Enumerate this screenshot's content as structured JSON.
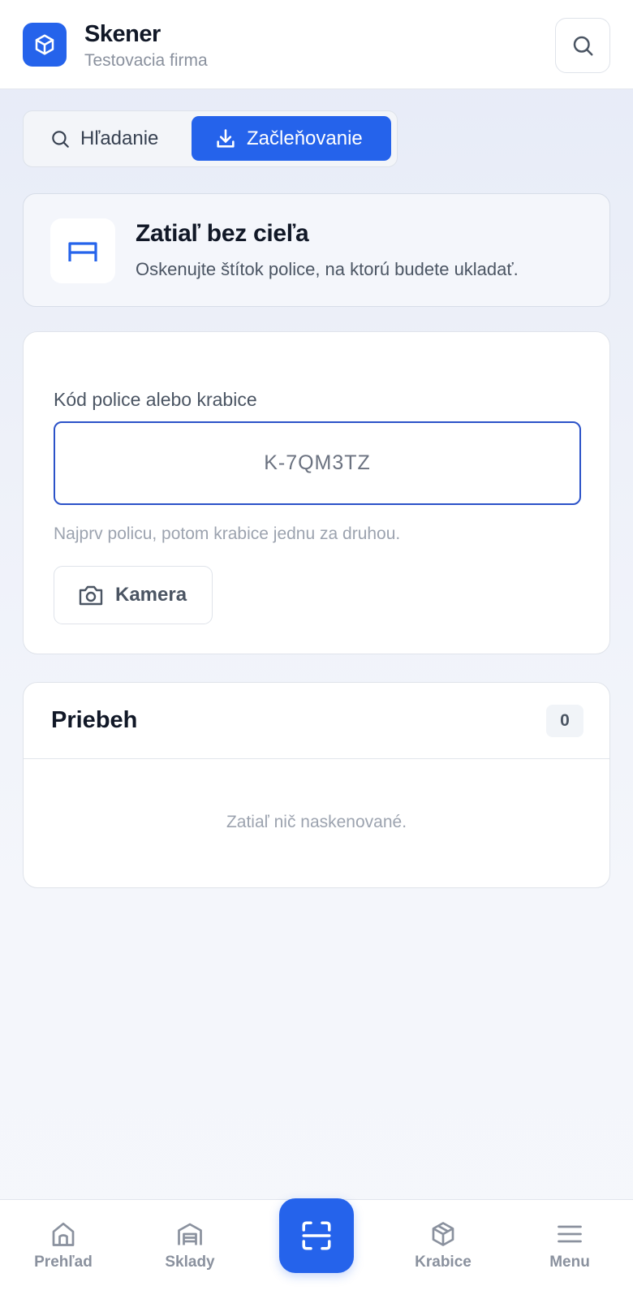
{
  "header": {
    "title": "Skener",
    "subtitle": "Testovacia firma",
    "logo_icon": "box-icon",
    "search_icon": "search-icon"
  },
  "mode_tabs": [
    {
      "label": "Hľadanie",
      "icon": "search-icon",
      "active": false
    },
    {
      "label": "Začleňovanie",
      "icon": "download-icon",
      "active": true
    }
  ],
  "target": {
    "title": "Zatiaľ bez cieľa",
    "description": "Oskenujte štítok police, na ktorú budete ukladať.",
    "icon": "shelf-icon"
  },
  "scan": {
    "field_label": "Kód police alebo krabice",
    "input_value": "",
    "input_placeholder": "K-7QM3TZ",
    "hint": "Najprv policu, potom krabice jednu za druhou.",
    "camera_label": "Kamera",
    "camera_icon": "camera-icon"
  },
  "progress": {
    "title": "Priebeh",
    "count": "0",
    "empty_text": "Zatiaľ nič naskenované."
  },
  "bottom_nav": {
    "items": [
      {
        "label": "Prehľad",
        "icon": "home-icon"
      },
      {
        "label": "Sklady",
        "icon": "warehouse-icon"
      },
      {
        "label": "Krabice",
        "icon": "box-icon"
      },
      {
        "label": "Menu",
        "icon": "menu-icon"
      }
    ],
    "scan_icon": "scan-icon"
  },
  "colors": {
    "accent": "#2563eb",
    "text_primary": "#111827",
    "text_muted": "#9ca3af",
    "input_border": "#2b52c8"
  }
}
